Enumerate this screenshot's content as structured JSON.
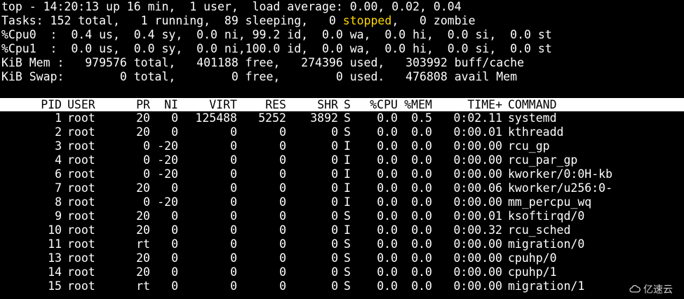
{
  "summary": {
    "line1": "top - 14:20:13 up 16 min,  1 user,  load average: 0.00, 0.02, 0.04",
    "line2_pre": "Tasks: 152 total,   1 running,  89 sleeping,   0 ",
    "line2_stopped": "stopped",
    "line2_post": ",   0 zombie",
    "line3": "%Cpu0  :  0.4 us,  0.4 sy,  0.0 ni, 99.2 id,  0.0 wa,  0.0 hi,  0.0 si,  0.0 st",
    "line4": "%Cpu1  :  0.0 us,  0.0 sy,  0.0 ni,100.0 id,  0.0 wa,  0.0 hi,  0.0 si,  0.0 st",
    "line5": "KiB Mem :   979576 total,   401188 free,   274396 used,   303992 buff/cache",
    "line6": "KiB Swap:        0 total,        0 free,        0 used.   476808 avail Mem"
  },
  "columns": {
    "pid": "PID",
    "user": "USER",
    "pr": "PR",
    "ni": "NI",
    "virt": "VIRT",
    "res": "RES",
    "shr": "SHR",
    "s": "S",
    "cpu": "%CPU",
    "mem": "%MEM",
    "time": "TIME+",
    "cmd": "COMMAND"
  },
  "processes": [
    {
      "pid": "1",
      "user": "root",
      "pr": "20",
      "ni": "0",
      "virt": "125488",
      "res": "5252",
      "shr": "3892",
      "s": "S",
      "cpu": "0.0",
      "mem": "0.5",
      "time": "0:02.11",
      "cmd": "systemd"
    },
    {
      "pid": "2",
      "user": "root",
      "pr": "20",
      "ni": "0",
      "virt": "0",
      "res": "0",
      "shr": "0",
      "s": "S",
      "cpu": "0.0",
      "mem": "0.0",
      "time": "0:00.01",
      "cmd": "kthreadd"
    },
    {
      "pid": "3",
      "user": "root",
      "pr": "0",
      "ni": "-20",
      "virt": "0",
      "res": "0",
      "shr": "0",
      "s": "I",
      "cpu": "0.0",
      "mem": "0.0",
      "time": "0:00.00",
      "cmd": "rcu_gp"
    },
    {
      "pid": "4",
      "user": "root",
      "pr": "0",
      "ni": "-20",
      "virt": "0",
      "res": "0",
      "shr": "0",
      "s": "I",
      "cpu": "0.0",
      "mem": "0.0",
      "time": "0:00.00",
      "cmd": "rcu_par_gp"
    },
    {
      "pid": "6",
      "user": "root",
      "pr": "0",
      "ni": "-20",
      "virt": "0",
      "res": "0",
      "shr": "0",
      "s": "I",
      "cpu": "0.0",
      "mem": "0.0",
      "time": "0:00.00",
      "cmd": "kworker/0:0H-kb"
    },
    {
      "pid": "7",
      "user": "root",
      "pr": "20",
      "ni": "0",
      "virt": "0",
      "res": "0",
      "shr": "0",
      "s": "I",
      "cpu": "0.0",
      "mem": "0.0",
      "time": "0:00.06",
      "cmd": "kworker/u256:0-"
    },
    {
      "pid": "8",
      "user": "root",
      "pr": "0",
      "ni": "-20",
      "virt": "0",
      "res": "0",
      "shr": "0",
      "s": "I",
      "cpu": "0.0",
      "mem": "0.0",
      "time": "0:00.00",
      "cmd": "mm_percpu_wq"
    },
    {
      "pid": "9",
      "user": "root",
      "pr": "20",
      "ni": "0",
      "virt": "0",
      "res": "0",
      "shr": "0",
      "s": "S",
      "cpu": "0.0",
      "mem": "0.0",
      "time": "0:00.01",
      "cmd": "ksoftirqd/0"
    },
    {
      "pid": "10",
      "user": "root",
      "pr": "20",
      "ni": "0",
      "virt": "0",
      "res": "0",
      "shr": "0",
      "s": "I",
      "cpu": "0.0",
      "mem": "0.0",
      "time": "0:00.32",
      "cmd": "rcu_sched"
    },
    {
      "pid": "11",
      "user": "root",
      "pr": "rt",
      "ni": "0",
      "virt": "0",
      "res": "0",
      "shr": "0",
      "s": "S",
      "cpu": "0.0",
      "mem": "0.0",
      "time": "0:00.00",
      "cmd": "migration/0"
    },
    {
      "pid": "13",
      "user": "root",
      "pr": "20",
      "ni": "0",
      "virt": "0",
      "res": "0",
      "shr": "0",
      "s": "S",
      "cpu": "0.0",
      "mem": "0.0",
      "time": "0:00.00",
      "cmd": "cpuhp/0"
    },
    {
      "pid": "14",
      "user": "root",
      "pr": "20",
      "ni": "0",
      "virt": "0",
      "res": "0",
      "shr": "0",
      "s": "S",
      "cpu": "0.0",
      "mem": "0.0",
      "time": "0:00.00",
      "cmd": "cpuhp/1"
    },
    {
      "pid": "15",
      "user": "root",
      "pr": "rt",
      "ni": "0",
      "virt": "0",
      "res": "0",
      "shr": "0",
      "s": "S",
      "cpu": "0.0",
      "mem": "0.0",
      "time": "0:00.00",
      "cmd": "migration/1"
    }
  ],
  "watermark": {
    "text": "亿速云",
    "icon": "cloud-logo-icon"
  },
  "colors": {
    "background": "#000000",
    "text": "#ffffff",
    "stopped": "#ffd900",
    "header_bg": "#ffffff"
  }
}
